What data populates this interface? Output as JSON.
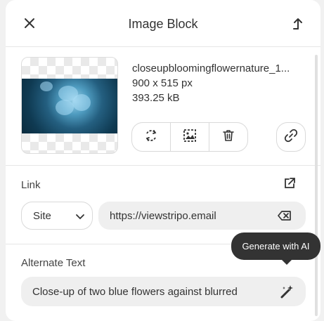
{
  "header": {
    "title": "Image Block",
    "close_icon": "close-icon",
    "export_icon": "export-arrow-icon"
  },
  "image": {
    "filename": "closeupbloomingflowernature_1...",
    "dimensions": "900 x 515 px",
    "size": "393.25 kB",
    "tools": [
      "replace-icon",
      "edit-image-icon",
      "delete-icon"
    ],
    "link_icon": "link-icon"
  },
  "link": {
    "label": "Link",
    "type_value": "Site",
    "url_value": "https://viewstripo.email",
    "external_icon": "external-link-icon",
    "clear_icon": "clear-input-icon"
  },
  "alt": {
    "label": "Alternate Text",
    "value": "Close-up of two blue flowers against blurred",
    "ai_icon": "magic-wand-icon",
    "tooltip": "Generate with AI"
  },
  "colors": {
    "panel": "#ffffff",
    "field": "#efefef",
    "border": "#d9d9d9",
    "tooltip": "#333333"
  }
}
